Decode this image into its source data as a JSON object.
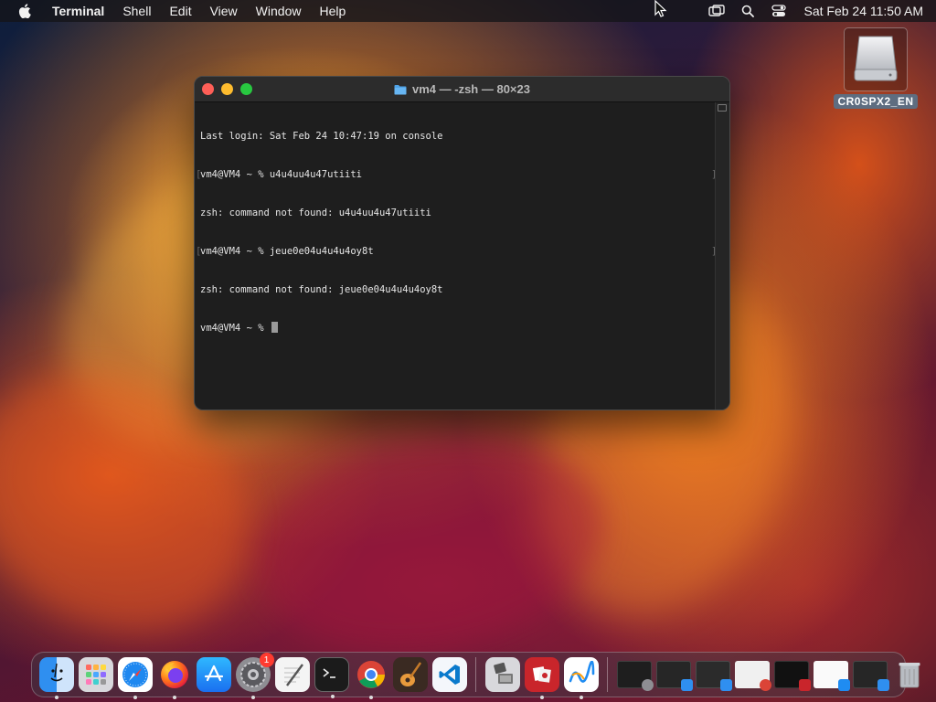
{
  "menubar": {
    "app_name": "Terminal",
    "items": [
      "Shell",
      "Edit",
      "View",
      "Window",
      "Help"
    ],
    "clock": "Sat Feb 24  11:50 AM",
    "status_icons": [
      "screen-mirroring-icon",
      "spotlight-search-icon",
      "control-center-icon"
    ]
  },
  "desktop": {
    "disk_label": "CR0SPX2_EN"
  },
  "terminal": {
    "title": "vm4 — -zsh — 80×23",
    "lines": [
      "Last login: Sat Feb 24 10:47:19 on console",
      "vm4@VM4 ~ % u4u4uu4u47utiiti",
      "zsh: command not found: u4u4uu4u47utiiti",
      "vm4@VM4 ~ % jeue0e04u4u4u4oy8t",
      "zsh: command not found: jeue0e04u4u4u4oy8t",
      "vm4@VM4 ~ % "
    ]
  },
  "dock": {
    "apps": [
      {
        "name": "finder-icon",
        "running": true
      },
      {
        "name": "launchpad-icon",
        "running": false
      },
      {
        "name": "safari-icon",
        "running": true
      },
      {
        "name": "firefox-icon",
        "running": true
      },
      {
        "name": "app-store-icon",
        "running": false
      },
      {
        "name": "system-settings-icon",
        "running": true,
        "badge": "1"
      },
      {
        "name": "textedit-icon",
        "running": false
      },
      {
        "name": "terminal-icon",
        "running": true
      },
      {
        "name": "chrome-icon",
        "running": true
      },
      {
        "name": "garageband-icon",
        "running": false
      },
      {
        "name": "vscode-icon",
        "running": false
      },
      {
        "name": "migration-assistant-icon",
        "running": false
      },
      {
        "name": "photo-booth-icon",
        "running": true
      },
      {
        "name": "freeform-icon",
        "running": true
      }
    ],
    "minimized_count": 7,
    "colors": {
      "red": "#ff5f57",
      "yellow": "#febc2e",
      "green": "#28c840",
      "badge": "#ff3b30"
    }
  }
}
